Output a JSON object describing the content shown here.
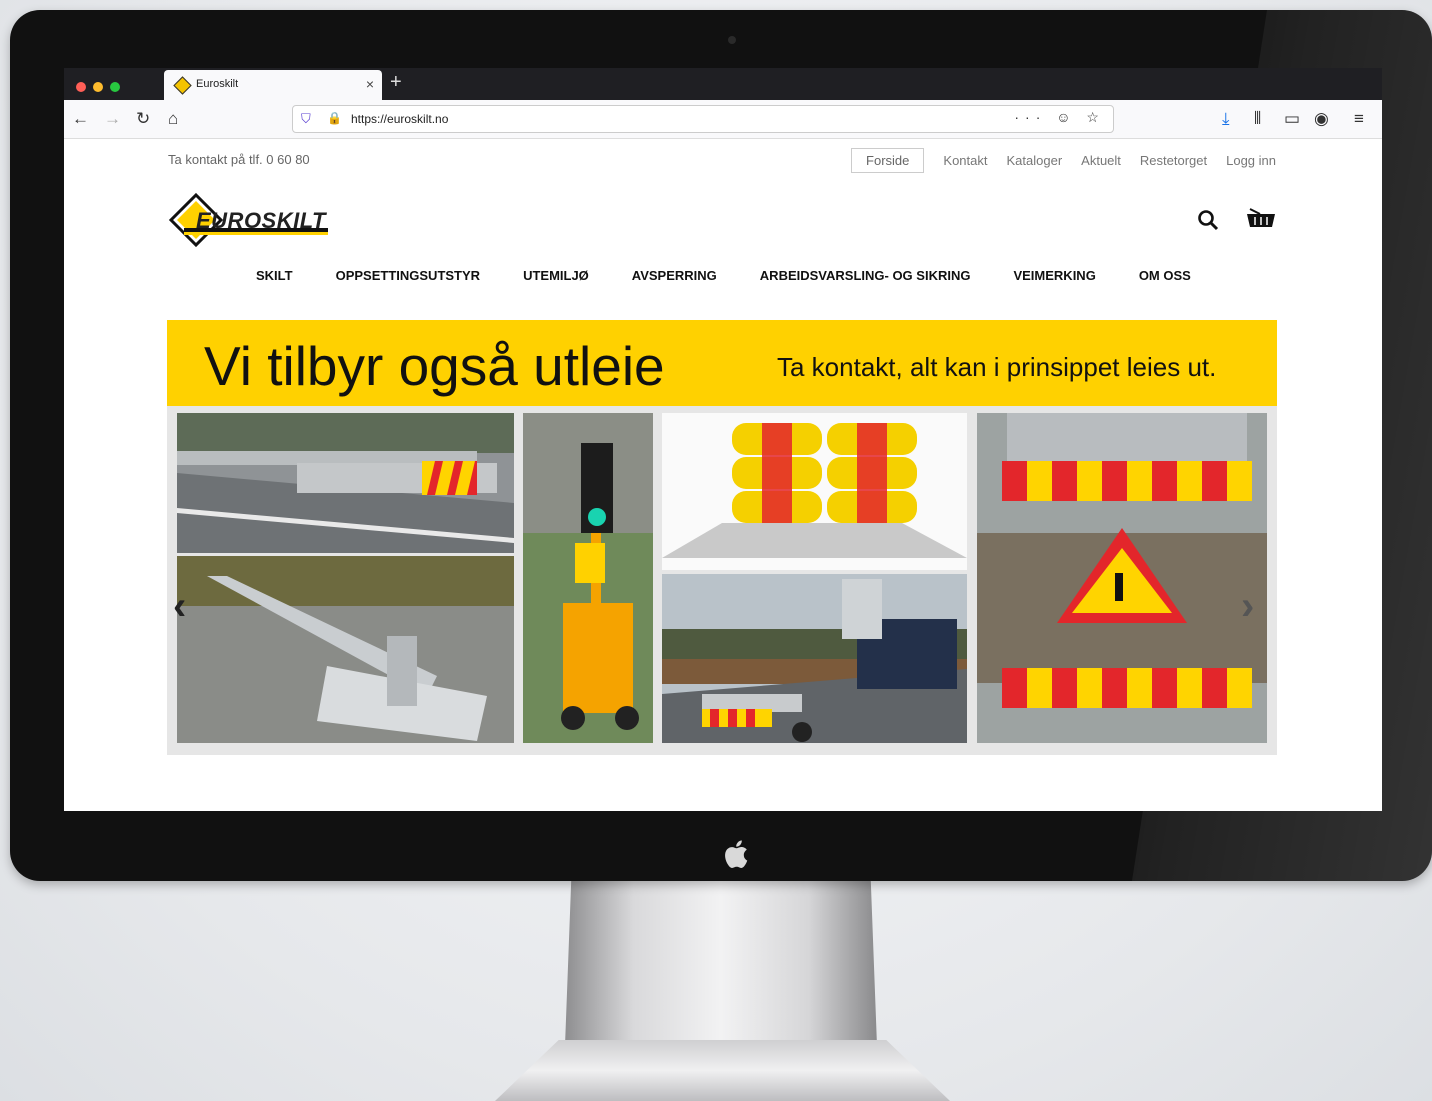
{
  "browser": {
    "tab_title": "Euroskilt",
    "tab_close": "×",
    "new_tab": "+",
    "url": "https://euroskilt.no",
    "url_actions": "··· ☺ ☆"
  },
  "site": {
    "contact_line": "Ta kontakt på tlf. 0 60 80",
    "top_links": {
      "forside": "Forside",
      "kontakt": "Kontakt",
      "kataloger": "Kataloger",
      "aktuelt": "Aktuelt",
      "restetorget": "Restetorget",
      "logg_inn": "Logg inn"
    },
    "logo_text": "EUROSKILT",
    "nav": {
      "skilt": "SKILT",
      "oppsetting": "OPPSETTINGSUTSTYR",
      "utemiljo": "UTEMILJØ",
      "avsperring": "AVSPERRING",
      "arbeidsvarsling": "ARBEIDSVARSLING- OG SIKRING",
      "veimerking": "VEIMERKING",
      "om_oss": "OM OSS"
    },
    "banner": {
      "headline": "Vi tilbyr også utleie",
      "subline": "Ta kontakt, alt kan i prinsippet leies ut."
    }
  },
  "colors": {
    "brand_yellow": "#ffd100",
    "warning_red": "#e3262b",
    "browser_dark": "#1f1f23"
  },
  "icons": [
    "search-icon",
    "cart-icon",
    "back-icon",
    "forward-icon",
    "reload-icon",
    "home-icon",
    "download-icon",
    "library-icon",
    "sidebar-icon",
    "account-icon",
    "menu-icon",
    "shield-icon",
    "lock-icon",
    "apple-icon"
  ]
}
